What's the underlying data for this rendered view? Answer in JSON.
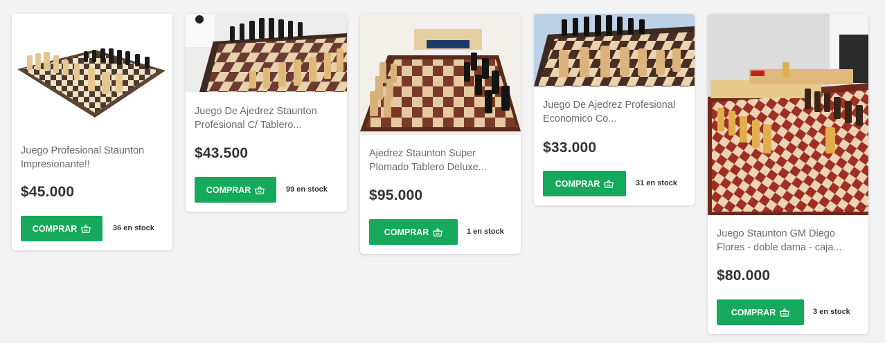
{
  "products": [
    {
      "title": "Juego Profesional Staunton Impresionante!!",
      "price": "$45.000",
      "button": "COMPRAR",
      "stock": "36 en stock",
      "icon": "basket-icon"
    },
    {
      "title": "Juego De Ajedrez Staunton Profesional C/ Tablero...",
      "price": "$43.500",
      "button": "COMPRAR",
      "stock": "99 en stock",
      "icon": "basket-icon"
    },
    {
      "title": "Ajedrez Staunton Super Plomado Tablero Deluxe...",
      "price": "$95.000",
      "button": "COMPRAR",
      "stock": "1 en stock",
      "icon": "basket-icon"
    },
    {
      "title": "Juego De Ajedrez Profesional Economico Co...",
      "price": "$33.000",
      "button": "COMPRAR",
      "stock": "31 en stock",
      "icon": "basket-icon"
    },
    {
      "title": "Juego Staunton GM Diego Flores - doble dama - caja...",
      "price": "$80.000",
      "button": "COMPRAR",
      "stock": "3 en stock",
      "icon": "basket-icon"
    }
  ],
  "colors": {
    "button": "#16a85b",
    "price": "#333333",
    "title": "#6a6a6a",
    "background": "#f3f3f3"
  }
}
